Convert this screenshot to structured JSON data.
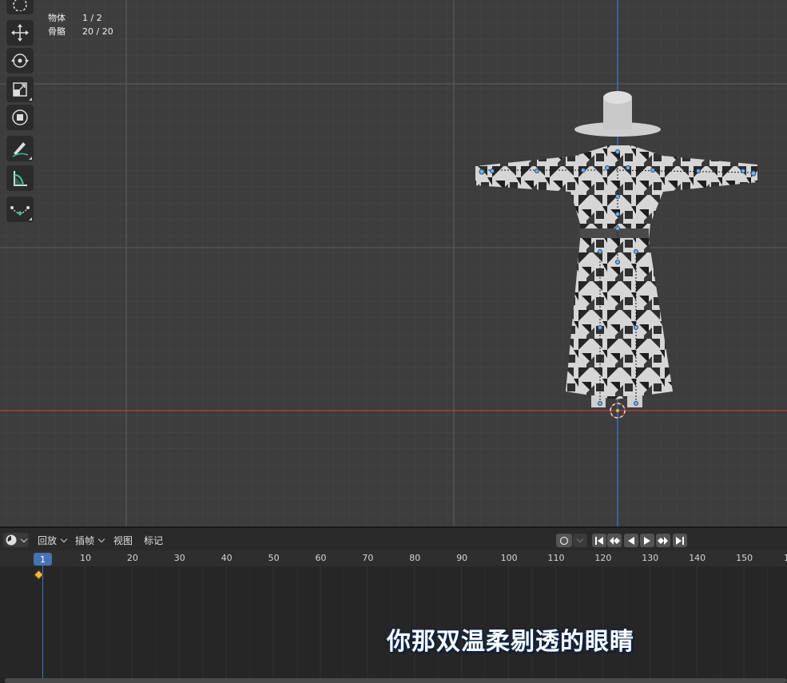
{
  "stats": {
    "objects_label": "物体",
    "objects_value": "1 / 2",
    "bones_label": "骨骼",
    "bones_value": "20 / 20"
  },
  "tools": [
    "cursor-tool",
    "move-tool",
    "rotate-tool",
    "scale-tool",
    "transform-tool",
    "annotate-tool",
    "measure-tool",
    "curve-tool"
  ],
  "timeline": {
    "editor_icon": "clock-icon",
    "menus": {
      "playback": "回放",
      "keying": "插帧",
      "view": "视图",
      "marker": "标记"
    },
    "current_frame": "1",
    "ruler_ticks": [
      "10",
      "20",
      "30",
      "40",
      "50",
      "60",
      "70",
      "80",
      "90",
      "100",
      "110",
      "120",
      "130",
      "140",
      "150",
      "1"
    ]
  },
  "subtitle": {
    "text": "你那双温柔剔透的眼睛"
  },
  "colors": {
    "x_axis": "#c0403c",
    "z_axis": "#3d7bd6",
    "frame_indicator": "#4772b3",
    "keyframe": "#f0b640"
  }
}
